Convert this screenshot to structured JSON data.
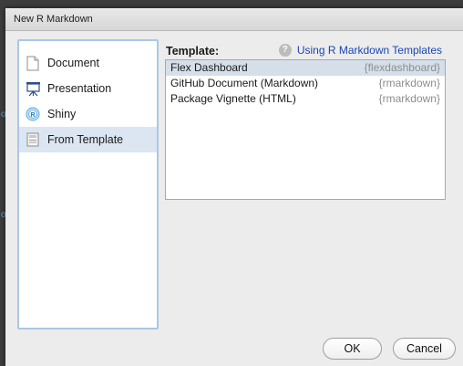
{
  "window": {
    "title": "New R Markdown"
  },
  "sidebar": {
    "items": [
      {
        "label": "Document",
        "icon": "document-icon"
      },
      {
        "label": "Presentation",
        "icon": "presentation-icon"
      },
      {
        "label": "Shiny",
        "icon": "shiny-icon"
      },
      {
        "label": "From Template",
        "icon": "template-icon",
        "selected": true
      }
    ]
  },
  "main": {
    "template_label": "Template:",
    "help_icon": "?",
    "help_link": "Using R Markdown Templates",
    "templates": [
      {
        "name": "Flex Dashboard",
        "package": "{flexdashboard}",
        "selected": true
      },
      {
        "name": "GitHub Document (Markdown)",
        "package": "{rmarkdown}"
      },
      {
        "name": "Package Vignette (HTML)",
        "package": "{rmarkdown}"
      }
    ]
  },
  "buttons": {
    "ok": "OK",
    "cancel": "Cancel"
  },
  "colors": {
    "selection": "#dbe6f2",
    "link": "#1a46b4",
    "focus_border": "#a9c7e7"
  }
}
